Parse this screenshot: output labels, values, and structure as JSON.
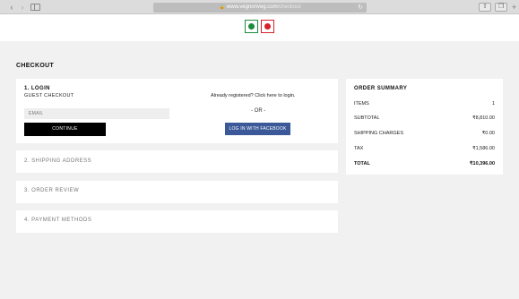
{
  "browser": {
    "address_host": "www.vegnonveg.com",
    "address_path": "/checkout"
  },
  "page": {
    "title": "CHECKOUT"
  },
  "login": {
    "title": "1. LOGIN",
    "guest_label": "GUEST CHECKOUT",
    "registered_text": "Already registered? Click here to login.",
    "email_placeholder": "EMAIL",
    "continue_label": "CONTINUE",
    "or_text": "- OR -",
    "facebook_label": "LOG IN WITH FACEBOOK"
  },
  "steps": [
    {
      "label": "2. SHIPPING ADDRESS"
    },
    {
      "label": "3. ORDER REVIEW"
    },
    {
      "label": "4. PAYMENT METHODS"
    }
  ],
  "summary": {
    "title": "ORDER SUMMARY",
    "rows": [
      {
        "label": "ITEMS",
        "value": "1"
      },
      {
        "label": "SUBTOTAL",
        "value": "₹8,810.00"
      },
      {
        "label": "SHIPPING CHARGES",
        "value": "₹0.00"
      },
      {
        "label": "TAX",
        "value": "₹1,586.00"
      }
    ],
    "total": {
      "label": "TOTAL",
      "value": "₹10,396.00"
    }
  },
  "colors": {
    "veg": "#1f8a3c",
    "nonveg": "#d6202a",
    "facebook": "#3b5998"
  }
}
